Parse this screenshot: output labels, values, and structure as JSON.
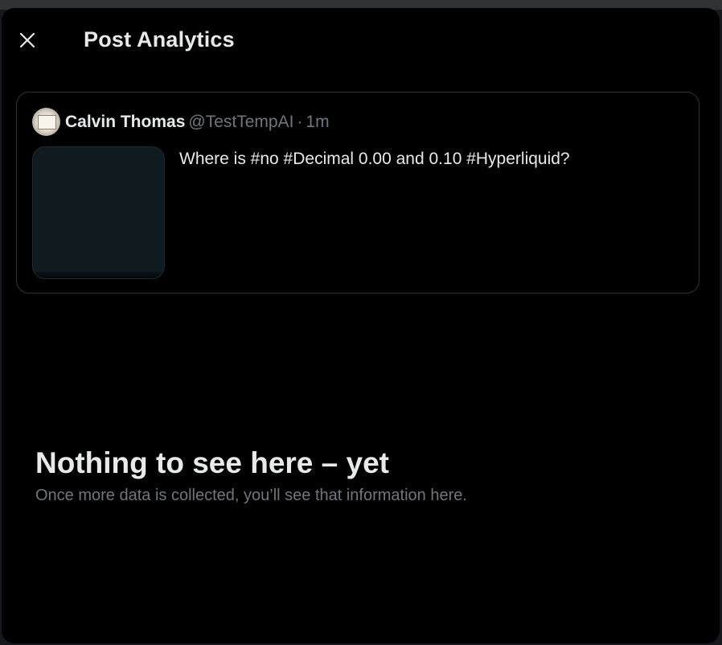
{
  "modal": {
    "title": "Post Analytics",
    "close_icon": "close-icon"
  },
  "post": {
    "author_name": "Calvin Thomas",
    "author_handle": "@TestTempAI",
    "separator": "·",
    "time": "1m",
    "text": "Where is #no #Decimal 0.00 and 0.10 #Hyperliquid?"
  },
  "empty_state": {
    "title": "Nothing to see here – yet",
    "subtitle": "Once more data is collected, you’ll see that information here."
  },
  "colors": {
    "background": "#000000",
    "primary_text": "#e7e9ea",
    "secondary_text": "#71767b",
    "border": "#2f3336"
  }
}
